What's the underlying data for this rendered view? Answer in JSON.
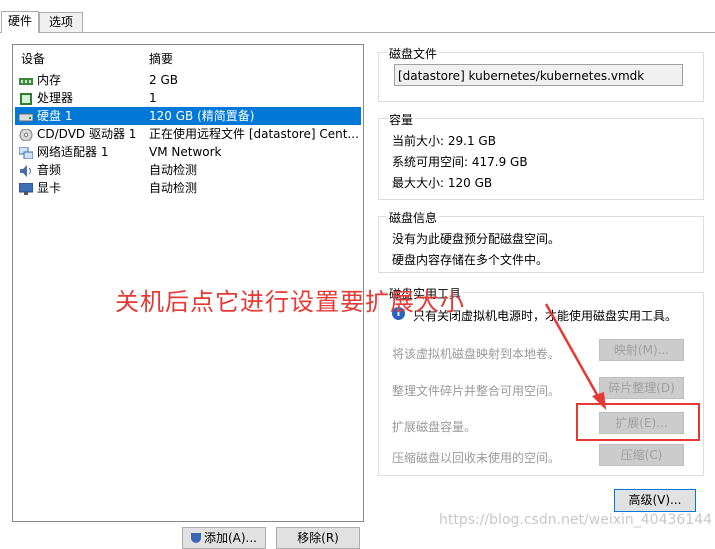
{
  "tabs": [
    {
      "label": "硬件",
      "active": true
    },
    {
      "label": "选项",
      "active": false
    }
  ],
  "device_list": {
    "columns": [
      "设备",
      "摘要"
    ],
    "rows": [
      {
        "icon": "memory-icon",
        "name": "内存",
        "summary": "2 GB",
        "selected": false
      },
      {
        "icon": "cpu-icon",
        "name": "处理器",
        "summary": "1",
        "selected": false
      },
      {
        "icon": "hard-disk-icon",
        "name": "硬盘 1",
        "summary": "120 GB (精简置备)",
        "selected": true
      },
      {
        "icon": "cd-dvd-icon",
        "name": "CD/DVD 驱动器 1",
        "summary": "正在使用远程文件 [datastore] Cent...",
        "selected": false
      },
      {
        "icon": "network-adapter-icon",
        "name": "网络适配器 1",
        "summary": "VM Network",
        "selected": false
      },
      {
        "icon": "audio-icon",
        "name": "音频",
        "summary": "自动检测",
        "selected": false
      },
      {
        "icon": "display-icon",
        "name": "显卡",
        "summary": "自动检测",
        "selected": false
      }
    ]
  },
  "disk_file": {
    "title": "磁盘文件",
    "value": "[datastore] kubernetes/kubernetes.vmdk"
  },
  "capacity": {
    "title": "容量",
    "current_size": "当前大小: 29.1 GB",
    "system_free": "系统可用空间: 417.9 GB",
    "max_size": "最大大小: 120 GB"
  },
  "disk_info": {
    "title": "磁盘信息",
    "line1": "没有为此硬盘预分配磁盘空间。",
    "line2": "硬盘内容存储在多个文件中。"
  },
  "disk_utilities": {
    "title": "磁盘实用工具",
    "info": "只有关闭虚拟机电源时，才能使用磁盘实用工具。",
    "map_label": "将该虚拟机磁盘映射到本地卷。",
    "map_button": "映射(M)...",
    "defrag_label": "整理文件碎片并整合可用空间。",
    "defrag_button": "碎片整理(D)",
    "expand_label": "扩展磁盘容量。",
    "expand_button": "扩展(E)...",
    "compact_label": "压缩磁盘以回收未使用的空间。",
    "compact_button": "压缩(C)"
  },
  "advanced_button": "高级(V)...",
  "add_button": "添加(A)...",
  "remove_button": "移除(R)",
  "annotation": "关机后点它进行设置要扩展大小",
  "watermark": "https://blog.csdn.net/weixin_40436144",
  "colors": {
    "selection": "#0078d7",
    "annotation": "#e53935"
  }
}
